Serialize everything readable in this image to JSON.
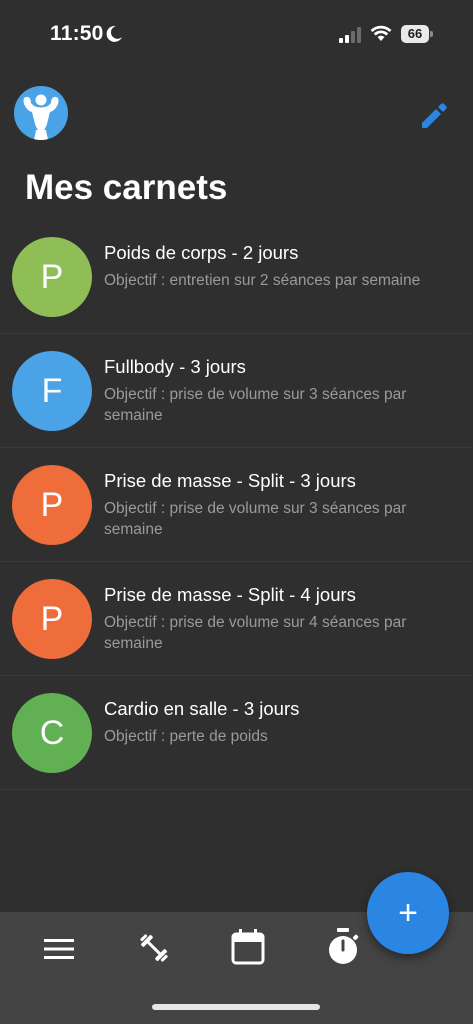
{
  "status_bar": {
    "time": "11:50",
    "battery": "66"
  },
  "header": {
    "title": "Mes carnets"
  },
  "carnets": [
    {
      "initial": "P",
      "title": "Poids de corps - 2 jours",
      "description": "Objectif : entretien sur 2 séances par semaine",
      "color": "#8fbe57"
    },
    {
      "initial": "F",
      "title": "Fullbody - 3 jours",
      "description": "Objectif : prise de volume sur 3 séances par semaine",
      "color": "#4aa3e6"
    },
    {
      "initial": "P",
      "title": "Prise de masse - Split - 3 jours",
      "description": "Objectif : prise de volume sur 3 séances par semaine",
      "color": "#ef6c3b"
    },
    {
      "initial": "P",
      "title": "Prise de masse - Split - 4 jours",
      "description": "Objectif : prise de volume sur 4 séances par semaine",
      "color": "#ef6c3b"
    },
    {
      "initial": "C",
      "title": "Cardio en salle - 3 jours",
      "description": "Objectif : perte de poids",
      "color": "#62b054"
    }
  ],
  "fab": {
    "label": "+"
  },
  "icons": {
    "edit": "pencil-icon",
    "nav": [
      "menu-icon",
      "dumbbell-icon",
      "calendar-icon",
      "stopwatch-icon"
    ]
  },
  "colors": {
    "background": "#2f2f2f",
    "accent": "#2b86e3",
    "nav_background": "#444444"
  }
}
